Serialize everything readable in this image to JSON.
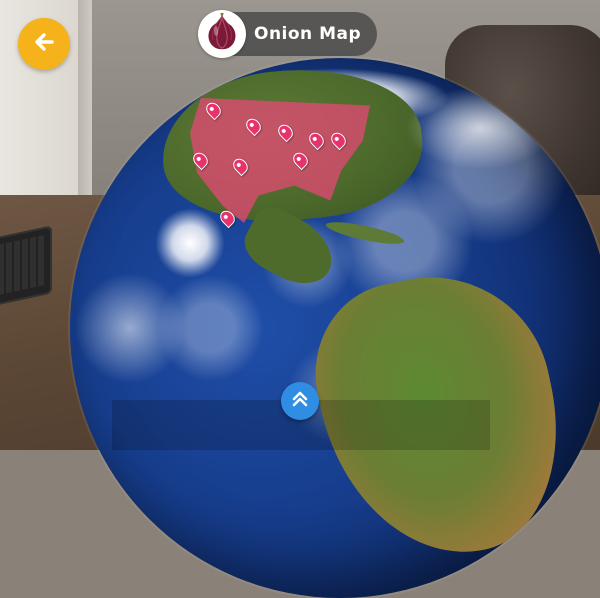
{
  "header": {
    "title": "Onion Map"
  },
  "icons": {
    "back": "arrow-left-icon",
    "badge": "onion-icon",
    "expand": "chevron-double-up-icon"
  },
  "colors": {
    "back_button": "#f5b21a",
    "title_pill": "#4b4b4b",
    "highlight_region": "#eb4678",
    "pin": "#e7336b",
    "expand_button": "#2f8de4"
  }
}
